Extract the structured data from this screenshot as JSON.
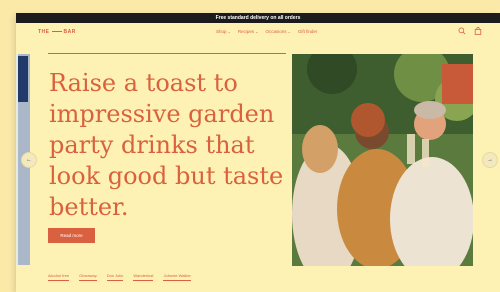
{
  "announcement": {
    "text": "Free standard delivery on all orders"
  },
  "logo": {
    "left": "THE",
    "right": "BAR"
  },
  "nav": {
    "items": [
      {
        "label": "Shop",
        "caret": "⌄"
      },
      {
        "label": "Recipes",
        "caret": "⌄"
      },
      {
        "label": "Occasions",
        "caret": "⌄"
      },
      {
        "label": "Gift finder",
        "caret": ""
      }
    ]
  },
  "icons": {
    "search": "search-icon",
    "bag": "shopping-bag-icon",
    "prev": "arrow-left-icon",
    "next": "arrow-right-icon"
  },
  "hero": {
    "headline": "Raise a toast to impressive garden party drinks that look good but taste better.",
    "cta_label": "Read more",
    "prev_arrow": "←",
    "next_arrow": "→"
  },
  "chips": [
    "Alcohol free",
    "Giveaway",
    "Don Julio",
    "Wanderlust",
    "Johnnie Walker"
  ],
  "colors": {
    "background": "#fbe9a8",
    "panel": "#fdf2b4",
    "accent": "#d9613f",
    "announcement_bar": "#1b1b1b"
  }
}
